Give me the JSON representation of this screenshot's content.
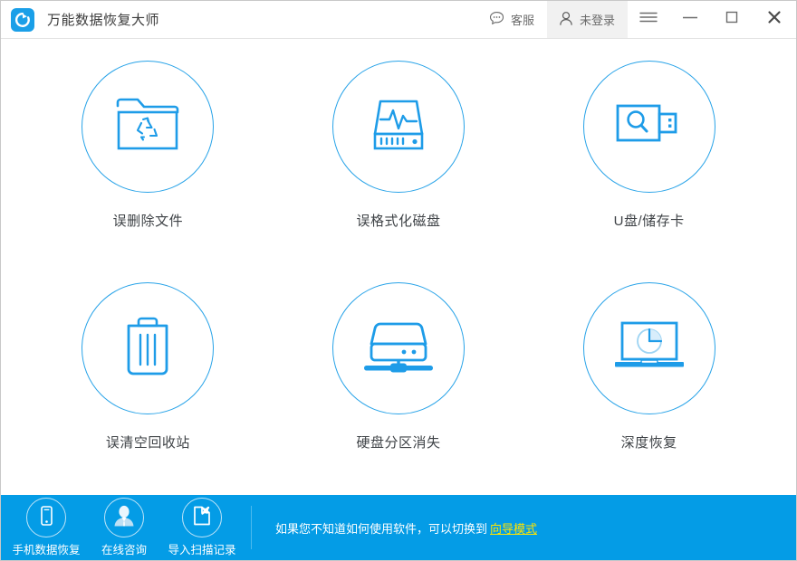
{
  "window": {
    "title": "万能数据恢复大师",
    "logo_icon": "refresh-circle-logo"
  },
  "titlebar": {
    "service": {
      "label": "客服",
      "icon": "chat-bubble-icon"
    },
    "login": {
      "label": "未登录",
      "icon": "user-icon"
    },
    "menu": {
      "icon": "hamburger-menu-icon"
    },
    "minimize": {
      "icon": "minimize-icon"
    },
    "maximize": {
      "icon": "maximize-icon"
    },
    "close": {
      "icon": "close-icon"
    }
  },
  "colors": {
    "accent": "#0a9ce6",
    "icon_blue": "#1e9ce8",
    "label_text": "#3f4347",
    "link_yellow": "#ffe400",
    "bottom_bar": "#049ce6"
  },
  "features": [
    {
      "label": "误删除文件",
      "icon": "folder-recycle-icon"
    },
    {
      "label": "误格式化磁盘",
      "icon": "harddisk-pulse-icon"
    },
    {
      "label": "U盘/储存卡",
      "icon": "usb-search-icon"
    },
    {
      "label": "误清空回收站",
      "icon": "trash-bin-icon"
    },
    {
      "label": "硬盘分区消失",
      "icon": "external-drive-icon"
    },
    {
      "label": "深度恢复",
      "icon": "laptop-scan-icon"
    }
  ],
  "bottombar": {
    "tools": [
      {
        "label": "手机数据恢复",
        "icon": "mobile-phone-icon"
      },
      {
        "label": "在线咨询",
        "icon": "person-avatar-icon"
      },
      {
        "label": "导入扫描记录",
        "icon": "import-document-icon"
      }
    ],
    "hint_text": "如果您不知道如何使用软件，可以切换到",
    "hint_link": "向导模式"
  }
}
